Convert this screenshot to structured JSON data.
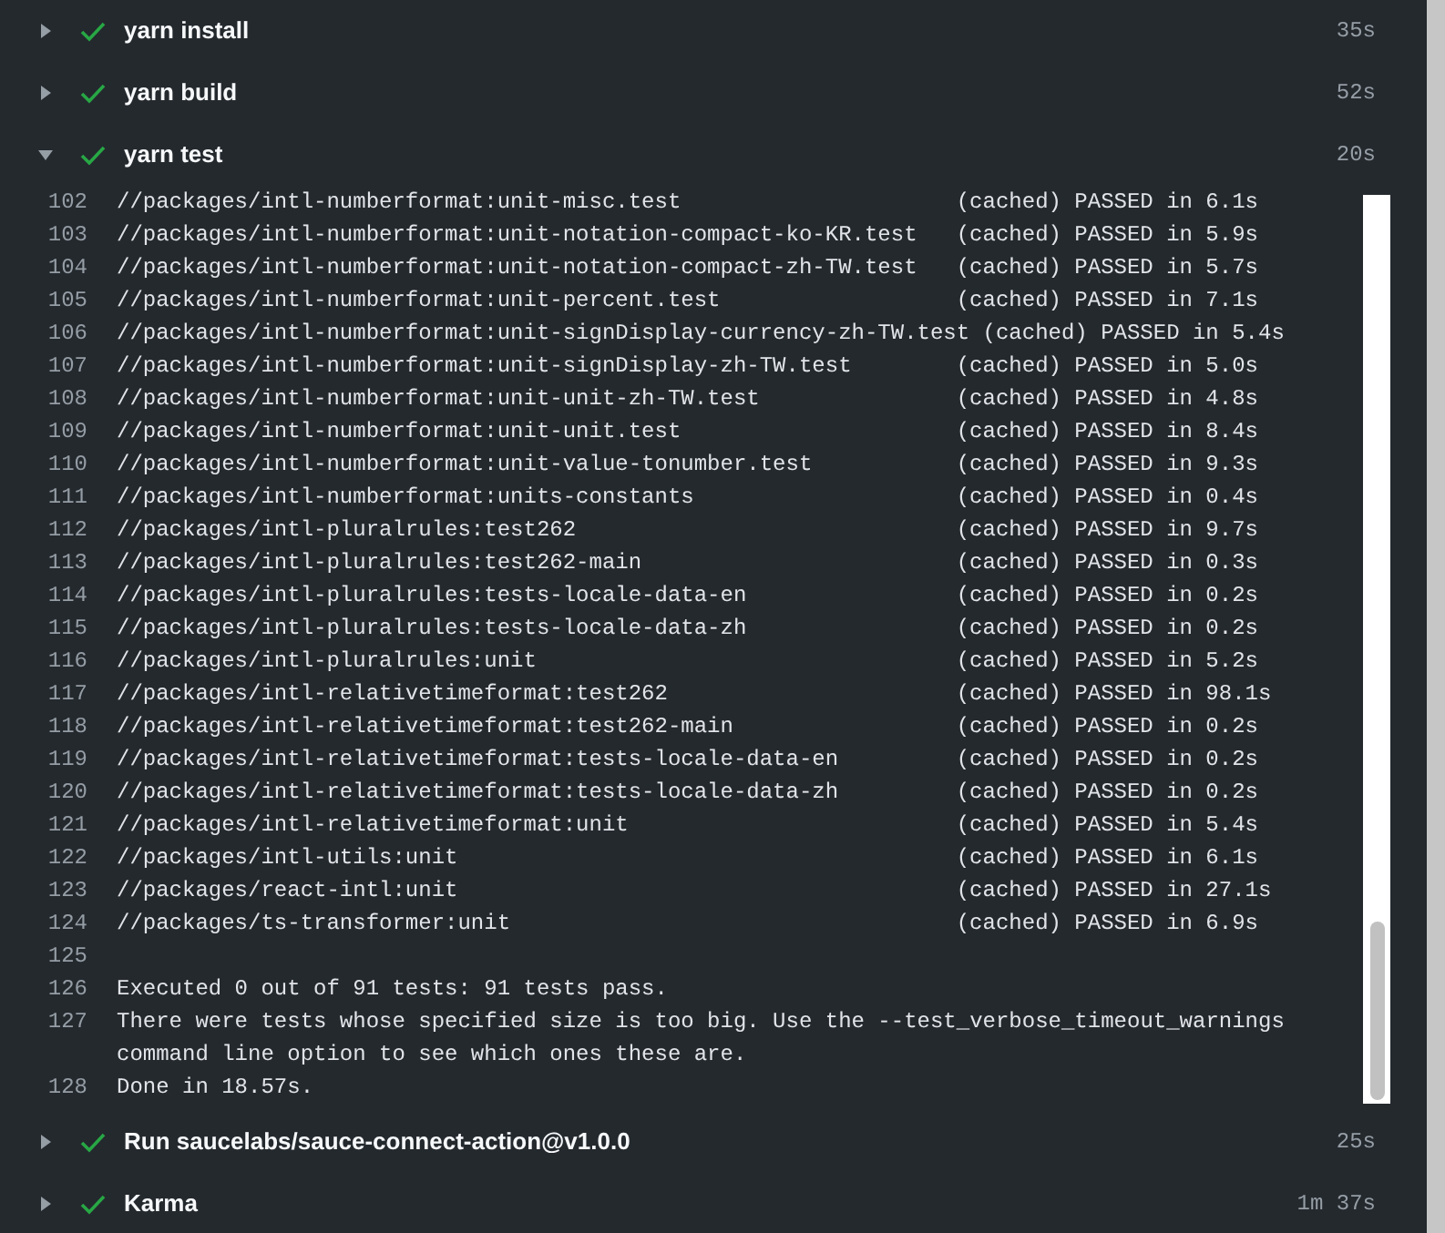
{
  "steps": [
    {
      "name": "yarn install",
      "expanded": false,
      "duration": "35s"
    },
    {
      "name": "yarn build",
      "expanded": false,
      "duration": "52s"
    },
    {
      "name": "yarn test",
      "expanded": true,
      "duration": "20s",
      "log": [
        {
          "number": "102",
          "target": "//packages/intl-numberformat:unit-misc.test",
          "result": "(cached) PASSED in 6.1s"
        },
        {
          "number": "103",
          "target": "//packages/intl-numberformat:unit-notation-compact-ko-KR.test",
          "result": "(cached) PASSED in 5.9s"
        },
        {
          "number": "104",
          "target": "//packages/intl-numberformat:unit-notation-compact-zh-TW.test",
          "result": "(cached) PASSED in 5.7s"
        },
        {
          "number": "105",
          "target": "//packages/intl-numberformat:unit-percent.test",
          "result": "(cached) PASSED in 7.1s"
        },
        {
          "number": "106",
          "target": "//packages/intl-numberformat:unit-signDisplay-currency-zh-TW.test",
          "result": "(cached) PASSED in 5.4s"
        },
        {
          "number": "107",
          "target": "//packages/intl-numberformat:unit-signDisplay-zh-TW.test",
          "result": "(cached) PASSED in 5.0s"
        },
        {
          "number": "108",
          "target": "//packages/intl-numberformat:unit-unit-zh-TW.test",
          "result": "(cached) PASSED in 4.8s"
        },
        {
          "number": "109",
          "target": "//packages/intl-numberformat:unit-unit.test",
          "result": "(cached) PASSED in 8.4s"
        },
        {
          "number": "110",
          "target": "//packages/intl-numberformat:unit-value-tonumber.test",
          "result": "(cached) PASSED in 9.3s"
        },
        {
          "number": "111",
          "target": "//packages/intl-numberformat:units-constants",
          "result": "(cached) PASSED in 0.4s"
        },
        {
          "number": "112",
          "target": "//packages/intl-pluralrules:test262",
          "result": "(cached) PASSED in 9.7s"
        },
        {
          "number": "113",
          "target": "//packages/intl-pluralrules:test262-main",
          "result": "(cached) PASSED in 0.3s"
        },
        {
          "number": "114",
          "target": "//packages/intl-pluralrules:tests-locale-data-en",
          "result": "(cached) PASSED in 0.2s"
        },
        {
          "number": "115",
          "target": "//packages/intl-pluralrules:tests-locale-data-zh",
          "result": "(cached) PASSED in 0.2s"
        },
        {
          "number": "116",
          "target": "//packages/intl-pluralrules:unit",
          "result": "(cached) PASSED in 5.2s"
        },
        {
          "number": "117",
          "target": "//packages/intl-relativetimeformat:test262",
          "result": "(cached) PASSED in 98.1s"
        },
        {
          "number": "118",
          "target": "//packages/intl-relativetimeformat:test262-main",
          "result": "(cached) PASSED in 0.2s"
        },
        {
          "number": "119",
          "target": "//packages/intl-relativetimeformat:tests-locale-data-en",
          "result": "(cached) PASSED in 0.2s"
        },
        {
          "number": "120",
          "target": "//packages/intl-relativetimeformat:tests-locale-data-zh",
          "result": "(cached) PASSED in 0.2s"
        },
        {
          "number": "121",
          "target": "//packages/intl-relativetimeformat:unit",
          "result": "(cached) PASSED in 5.4s"
        },
        {
          "number": "122",
          "target": "//packages/intl-utils:unit",
          "result": "(cached) PASSED in 6.1s"
        },
        {
          "number": "123",
          "target": "//packages/react-intl:unit",
          "result": "(cached) PASSED in 27.1s"
        },
        {
          "number": "124",
          "target": "//packages/ts-transformer:unit",
          "result": "(cached) PASSED in 6.9s"
        },
        {
          "number": "125"
        },
        {
          "number": "126",
          "text": "Executed 0 out of 91 tests: 91 tests pass."
        },
        {
          "number": "127",
          "text": "There were tests whose specified size is too big. Use the --test_verbose_timeout_warnings command line option to see which ones these are."
        },
        {
          "number": "128",
          "text": "Done in 18.57s."
        }
      ]
    },
    {
      "name": "Run saucelabs/sauce-connect-action@v1.0.0",
      "expanded": false,
      "duration": "25s"
    },
    {
      "name": "Karma",
      "expanded": false,
      "duration": "1m 37s"
    }
  ]
}
